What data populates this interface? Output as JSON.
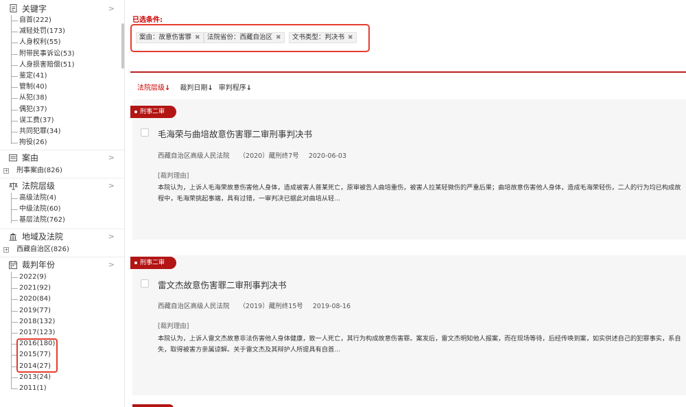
{
  "sidebar": {
    "keyword": {
      "title": "关键字",
      "items": [
        "自首(222)",
        "减轻处罚(173)",
        "人身权利(55)",
        "附带民事诉讼(53)",
        "人身损害赔偿(51)",
        "鉴定(41)",
        "管制(40)",
        "从犯(38)",
        "偶犯(37)",
        "误工费(37)",
        "共同犯罪(34)",
        "拘役(26)"
      ]
    },
    "case_cause": {
      "title": "案由",
      "items": [
        "刑事案由(826)"
      ]
    },
    "court_level": {
      "title": "法院层级",
      "items": [
        "高级法院(4)",
        "中级法院(60)",
        "基层法院(762)"
      ]
    },
    "region": {
      "title": "地域及法院",
      "items": [
        "西藏自治区(826)"
      ]
    },
    "year": {
      "title": "裁判年份",
      "items": [
        "2022(9)",
        "2021(92)",
        "2020(84)",
        "2019(77)",
        "2018(132)",
        "2017(123)",
        "2016(180)",
        "2015(77)",
        "2014(27)",
        "2013(24)",
        "2011(1)"
      ]
    },
    "chevron": ">"
  },
  "filters": {
    "label": "已选条件:",
    "chips": [
      "案由：故意伤害罪",
      "法院省份：西藏自治区",
      "文书类型：判决书"
    ],
    "remove_glyph": "✖"
  },
  "sort": {
    "items": [
      {
        "label": "法院层级",
        "arrow": "↓"
      },
      {
        "label": "裁判日期",
        "arrow": "↓"
      },
      {
        "label": "审判程序",
        "arrow": "↓"
      }
    ]
  },
  "results": [
    {
      "tag": "刑事二审",
      "title": "毛海荣与曲培故意伤害罪二审刑事判决书",
      "court": "西藏自治区高级人民法院",
      "case_no": "（2020）藏刑终7号",
      "date": "2020-06-03",
      "reason_label": "[裁判理由]",
      "text_line1": "本院认为，上诉人毛海荣故意伤害他人身体，造成被害人普某死亡，原审被告人曲培重伤，被害人拉某轻微伤的严重后果；曲培故意伤害他人身体，造成毛海荣轻伤，二人的行为均已构成故",
      "text_line2": "程中，毛海荣挑起事端，具有过错，一审判决已据此对曲培从轻..."
    },
    {
      "tag": "刑事二审",
      "title": "雷文杰故意伤害罪二审刑事判决书",
      "court": "西藏自治区高级人民法院",
      "case_no": "（2019）藏刑终15号",
      "date": "2019-08-16",
      "reason_label": "[裁判理由]",
      "text_line1": "本院认为，上诉人雷文杰故意非法伤害他人身体健康，致一人死亡，其行为构成故意伤害罪。案发后，雷文杰明知他人报案，而在现场等待，后经传唤到案，如实供述自己的犯罪事实，系自",
      "text_line2": "失，取得被害方亲属谅解。关于雷文杰及其辩护人所提具有自首..."
    }
  ],
  "colors": {
    "accent": "#b31515",
    "highlight": "#e53b2c"
  }
}
